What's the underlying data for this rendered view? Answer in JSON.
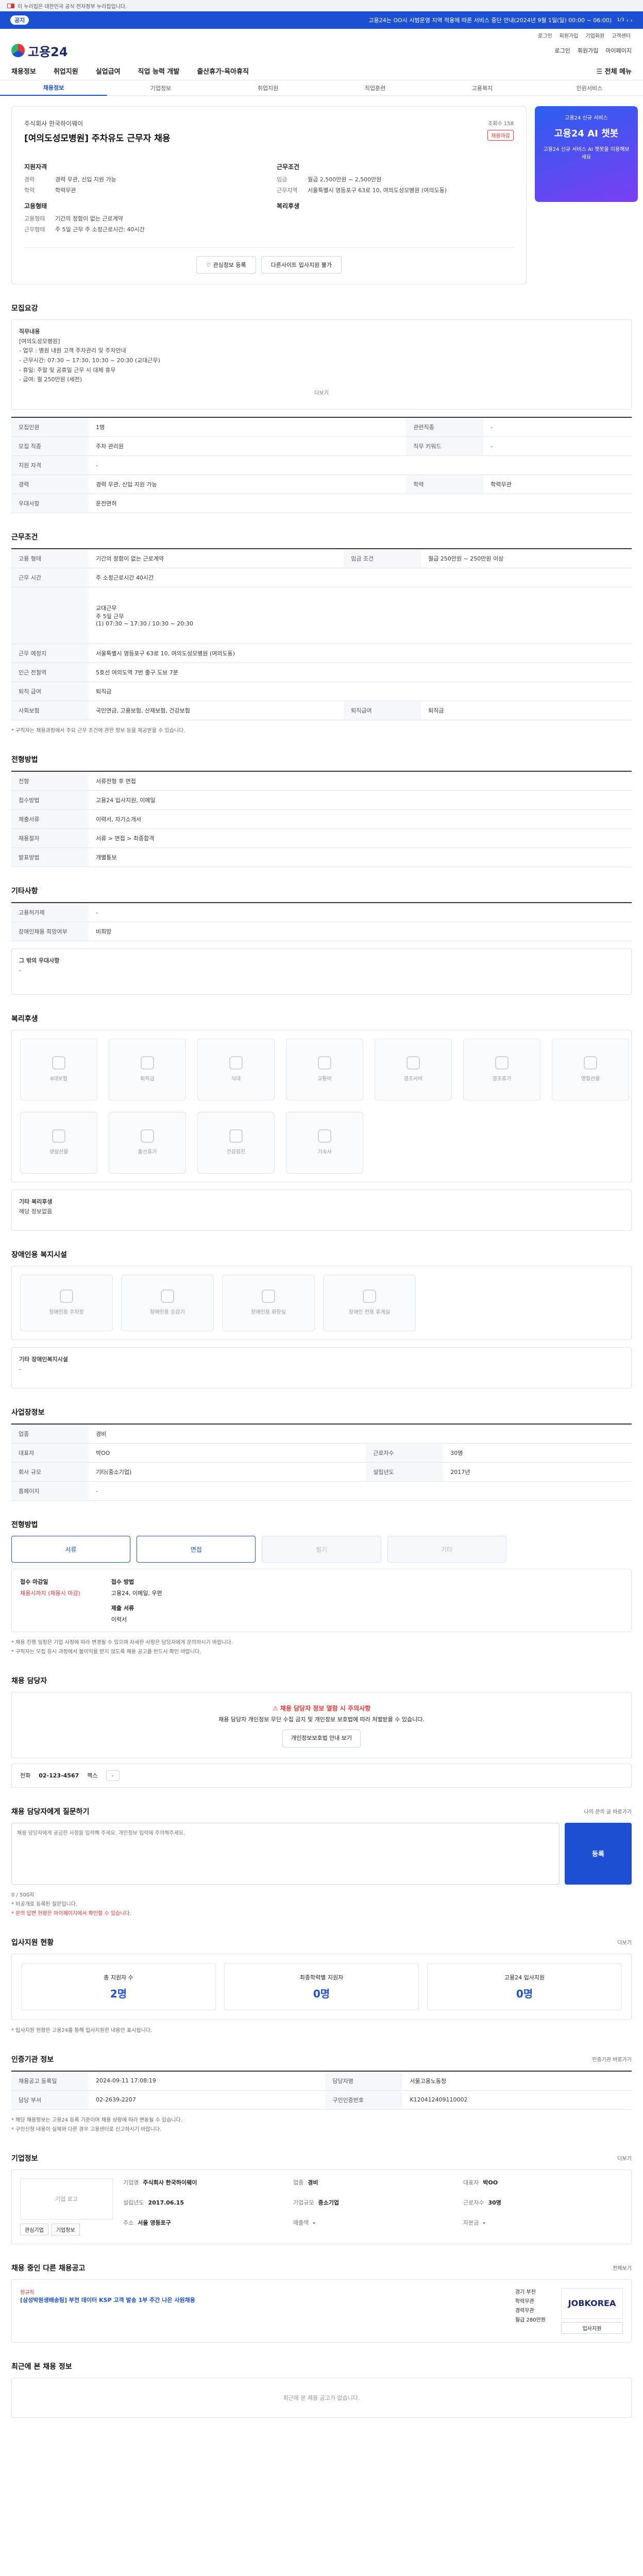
{
  "gov_banner": "이 누리집은 대한민국 공식 전자정부 누리집입니다.",
  "announcement": {
    "tag": "공지",
    "message": "고용24는 OO시 시범운영 지역 적용에 따른 서비스 중단 안내(2024년 9월 1일(일) 00:00 ~ 06:00)",
    "control": "1/3"
  },
  "util_links": [
    "로그인",
    "회원가입",
    "기업회원",
    "고객센터"
  ],
  "logo": "고용24",
  "tools": [
    "로그인",
    "회원가입",
    "마이페이지"
  ],
  "gnb": [
    "채용정보",
    "취업지원",
    "실업급여",
    "직업 능력 개발",
    "출산휴가·육아휴직"
  ],
  "gnb_all": "전체 메뉴",
  "subtabs": [
    "채용정보",
    "기업정보",
    "취업지원",
    "직업훈련",
    "고용복지",
    "민원서비스"
  ],
  "job": {
    "company": "주식회사 한국하이웨이",
    "title": "[여의도성모병원] 주차유도 근무자 채용",
    "views": "조회수 158",
    "badge": "채용마감",
    "left_title": "지원자격",
    "right_title": "근무조건",
    "left": [
      {
        "k": "경력",
        "v": "경력 무관, 신입 지원 가능"
      },
      {
        "k": "학력",
        "v": "학력무관"
      }
    ],
    "right": [
      {
        "k": "임금",
        "v": "월급 2,500만원 ~ 2,500만원"
      },
      {
        "k": "근무지역",
        "v": "서울특별시 영등포구 63로 10, 여의도성모병원 (여의도동)"
      }
    ],
    "left2_title": "고용형태",
    "left2": [
      {
        "k": "고용형태",
        "v": "기간의 정함이 없는 근로계약"
      },
      {
        "k": "근무형태",
        "v": "주 5일 근무 주 소정근로시간: 40시간"
      }
    ],
    "right2_title": "복리후생",
    "actions": [
      "관심정보 등록",
      "다른사이트 입사지원 불가"
    ]
  },
  "ad": {
    "small": "고용24 신규 서비스",
    "big": "고용24 AI 챗봇",
    "text": "고용24 신규 서비스 AI 챗봇을 이용해보세요"
  },
  "recruit": {
    "title": "모집요강",
    "duty_title": "직무내용",
    "duty": "[여의도성모병원]\n- 업무 : 병원 내원 고객 주차관리 및 주차안내\n- 근무시간: 07:30 ~ 17:30, 10:30 ~ 20:30 (교대근무)\n- 휴일: 주말 및 공휴일 근무 시 대체 휴무\n- 급여: 월 250만원 (세전)",
    "more": "더보기",
    "rows": [
      [
        "모집인원",
        "1명",
        "관련직종",
        "-"
      ],
      [
        "모집 직종",
        "주차 관리원",
        "직무 키워드",
        "-"
      ],
      [
        "지원 자격",
        "-",
        "",
        ""
      ],
      [
        "경력",
        "경력 무관, 신입 지원 가능",
        "학력",
        "학력무관"
      ],
      [
        "우대사항",
        "운전면허",
        "",
        ""
      ]
    ]
  },
  "work": {
    "title": "근무조건",
    "rows": [
      [
        "고용 형태",
        "기간의 정함이 없는 근로계약",
        "임금 조건",
        "월급 250만원 ~ 250만원 이상"
      ],
      [
        "근무 시간",
        "주 소정근로시간 40시간",
        "",
        ""
      ],
      [
        "",
        "교대근무\n주 5일 근무\n(1) 07:30 ~ 17:30 / 10:30 ~ 20:30",
        "",
        ""
      ],
      [
        "근무 예정지",
        "서울특별시 영등포구 63로 10, 여의도성모병원 (여의도동)",
        "",
        ""
      ],
      [
        "인근 전철역",
        "5호선 여의도역 7번 출구 도보 7분",
        "",
        ""
      ],
      [
        "퇴직 급여",
        "퇴직금",
        "",
        ""
      ],
      [
        "사회보험",
        "국민연금, 고용보험, 산재보험, 건강보험",
        "퇴직급여",
        "퇴직금"
      ]
    ],
    "note": "* 구직자는 채용과정에서 주요 근무 조건에 관한 정보 등을 제공받을 수 있습니다."
  },
  "process": {
    "title": "전형방법",
    "rows": [
      [
        "전형",
        "서류전형 후 면접"
      ],
      [
        "접수방법",
        "고용24 입사지원, 이메일"
      ],
      [
        "제출서류",
        "이력서, 자기소개서"
      ],
      [
        "채용절차",
        "서류 > 면접 > 최종합격"
      ],
      [
        "발표방법",
        "개별통보"
      ]
    ]
  },
  "edu": {
    "title": "기타사항",
    "rows": [
      [
        "고용허가제",
        "-"
      ],
      [
        "장애인채용 희망여부",
        "비희망"
      ]
    ],
    "more_title": "그 밖의 우대사항",
    "more_text": "-"
  },
  "welfare": {
    "title": "복리후생",
    "tiles": [
      "4대보험",
      "퇴직금",
      "식대",
      "교통비",
      "경조사비",
      "경조휴가",
      "명절선물",
      "생일선물",
      "출산휴가",
      "건강검진",
      "기숙사"
    ],
    "etc_title": "기타 복리후생",
    "etc": "해당 정보없음"
  },
  "disabled": {
    "title": "장애인용 복지시설",
    "tiles": [
      "장애인용 주차장",
      "장애인용 승강기",
      "장애인용 화장실",
      "장애인 전용 휴게실"
    ],
    "etc_title": "기타 장애인복지시설",
    "etc": "-"
  },
  "worksite": {
    "title": "사업장정보",
    "rows": [
      [
        "업종",
        "경비",
        "",
        ""
      ],
      [
        "대표자",
        "박OO",
        "근로자수",
        "30명"
      ],
      [
        "회사 규모",
        "기타(중소기업)",
        "설립년도",
        "2017년"
      ],
      [
        "홈페이지",
        "-",
        "",
        ""
      ]
    ]
  },
  "selection": {
    "title": "전형방법",
    "steps": [
      "서류",
      "면접",
      "필기",
      "기타"
    ],
    "receipt_title": "접수 마감일",
    "receipt": "채용시까지 (채용시 마감)",
    "method_title": "접수 방법",
    "method": "고용24, 이메일, 우편",
    "docs_title": "제출 서류",
    "docs": "이력서",
    "notes": [
      "* 채용 진행 일정은 기업 사정에 따라 변경될 수 있으며 자세한 사항은 담당자에게 문의하시기 바랍니다.",
      "* 구직자는 모집 응시 과정에서 불이익을 받지 않도록 채용 공고를 반드시 확인 바랍니다."
    ]
  },
  "contact": {
    "title": "채용 담당자",
    "warn": "채용 담당자 정보 열람 시 주의사항",
    "text": "채용 담당자 개인정보 무단 수집 금지 및 개인정보 보호법에 따라 처벌받을 수 있습니다.",
    "btn": "개인정보보호법 안내 보기",
    "phone_label": "전화",
    "phone": "02-123-4567",
    "fax_label": "팩스",
    "fax": "-"
  },
  "qa": {
    "title": "채용 담당자에게 질문하기",
    "link": "나의 문의 글 바로가기",
    "placeholder": "채용 담당자에게 궁금한 사항을 입력해 주세요. 개인정보 입력에 주의해주세요.",
    "count": "0 / 500자",
    "send": "등록",
    "notes": [
      "* 비공개로 등록된 질문입니다.",
      "* 문의 답변 현황은 마이페이지에서 확인할 수 있습니다."
    ]
  },
  "stats": {
    "title": "입사지원 현황",
    "more": "더보기",
    "items": [
      {
        "label": "총 지원자 수",
        "value": "2명"
      },
      {
        "label": "최종학력별 지원자",
        "value": "0명"
      },
      {
        "label": "고용24 입사지원",
        "value": "0명"
      }
    ],
    "note": "* 입사지원 현황은 고용24를 통해 입사지원한 내용만 표시됩니다."
  },
  "agency": {
    "title": "인증기관 정보",
    "btn": "인증기관 바로가기",
    "rows": [
      [
        "채용공고 등록일",
        "2024-09-11 17:08:19",
        "담당자명",
        "서울고용노동청"
      ],
      [
        "담당 부서",
        "02-2639-2207",
        "구인인증번호",
        "K120412409110002"
      ]
    ],
    "notes": [
      "* 해당 채용정보는 고용24 등록 기준이며 채용 상황에 따라 변동될 수 있습니다.",
      "* 구인신청 내용이 실제와 다른 경우 고용센터로 신고하시기 바랍니다."
    ]
  },
  "company": {
    "title": "기업정보",
    "more": "더보기",
    "logo": "기업 로고",
    "btns": [
      "관심기업",
      "기업정보"
    ],
    "info": [
      [
        "기업명",
        "주식회사 한국하이웨이"
      ],
      [
        "업종",
        "경비"
      ],
      [
        "대표자",
        "박OO"
      ],
      [
        "설립년도",
        "2017.06.15"
      ],
      [
        "기업규모",
        "중소기업"
      ],
      [
        "근로자수",
        "30명"
      ],
      [
        "주소",
        "서울 영등포구"
      ],
      [
        "매출액",
        "-"
      ],
      [
        "자본금",
        "-"
      ]
    ]
  },
  "other": {
    "title": "채용 중인 다른 채용공고",
    "more": "전체보기",
    "kind": "정규직",
    "job": "[삼성박원생배송팀] 부천 데이터 KSP 고객 발송 1부 주간 나은 사원채용",
    "meta": [
      "경기 부천",
      "학력무관",
      "경력무관",
      "월급 280만원"
    ],
    "logo": "JOBKOREA",
    "btn": "입사지원"
  },
  "recent": {
    "title": "최근에 본 채용 정보",
    "empty": "최근에 본 채용 공고가 없습니다."
  }
}
